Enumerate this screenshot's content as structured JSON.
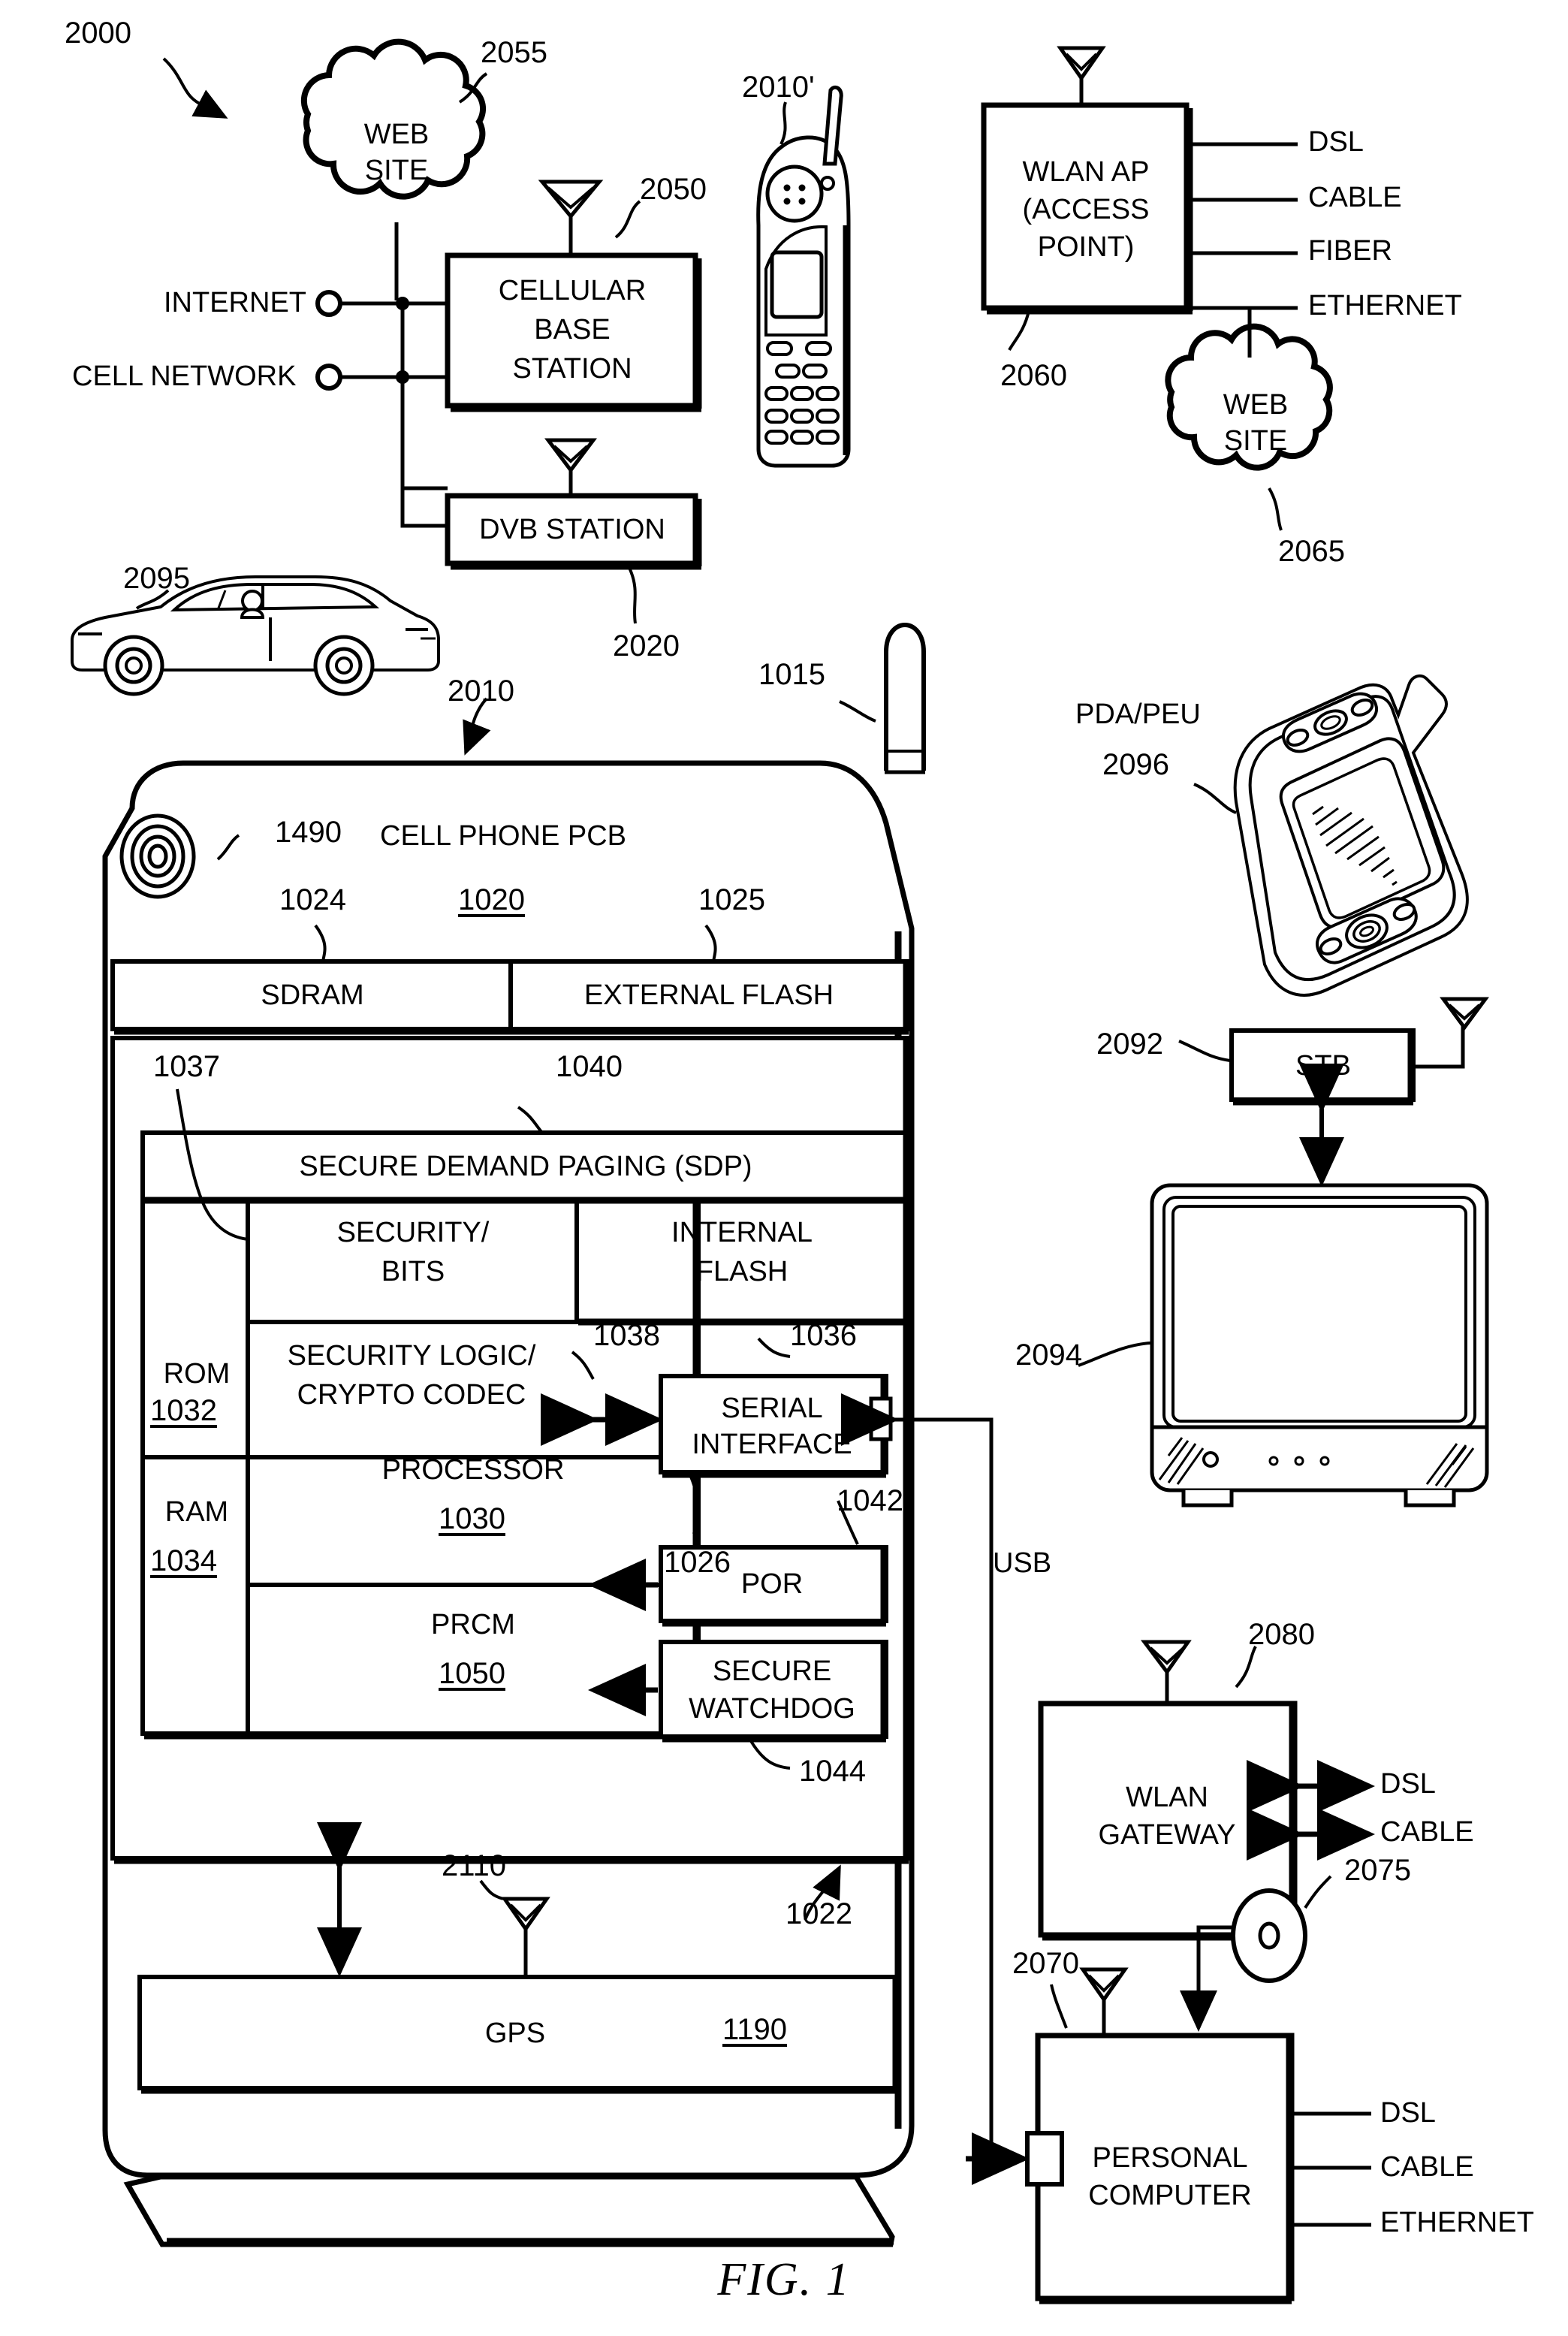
{
  "figure": {
    "caption": "FIG. 1",
    "system_ref": "2000"
  },
  "network": {
    "web_site_left": {
      "label_line1": "WEB",
      "label_line2": "SITE",
      "ref": "2055"
    },
    "web_site_right": {
      "label_line1": "WEB",
      "label_line2": "SITE",
      "ref": "2065"
    },
    "internet_port": "INTERNET",
    "cell_network_port": "CELL NETWORK",
    "cellular_base_station": {
      "line1": "CELLULAR",
      "line2": "BASE",
      "line3": "STATION",
      "ref": "2050"
    },
    "dvb_station": {
      "label": "DVB STATION",
      "ref": "2020"
    },
    "wlan_ap": {
      "line1": "WLAN AP",
      "line2": "(ACCESS",
      "line3": "POINT)",
      "ref": "2060",
      "links": [
        "DSL",
        "CABLE",
        "FIBER",
        "ETHERNET"
      ]
    },
    "wlan_gateway": {
      "line1": "WLAN",
      "line2": "GATEWAY",
      "ref": "2080",
      "links": [
        "DSL",
        "CABLE"
      ]
    },
    "personal_computer": {
      "line1": "PERSONAL",
      "line2": "COMPUTER",
      "ref": "2070",
      "links": [
        "DSL",
        "CABLE",
        "ETHERNET"
      ],
      "disc_ref": "2075"
    },
    "stb": {
      "label": "STB",
      "ref": "2092"
    },
    "television": {
      "ref": "2094"
    },
    "pda": {
      "label": "PDA/PEU",
      "ref": "2096"
    },
    "car": {
      "ref": "2095"
    },
    "handset": {
      "ref": "2010'"
    },
    "usb_label": "USB"
  },
  "phone": {
    "title": "CELL PHONE PCB",
    "device_ref": "2010",
    "pcb_ref": "1020",
    "speaker_ref": "1490",
    "antenna_ref": "1015",
    "chip_ref": "1022",
    "gps_link_ref": "2110",
    "memory": [
      {
        "label": "SDRAM",
        "ref": "1024"
      },
      {
        "label": "EXTERNAL FLASH",
        "ref": "1025"
      }
    ],
    "sdp": {
      "label": "SECURE DEMAND PAGING (SDP)",
      "ref": "1040"
    },
    "security_bits": {
      "line1": "SECURITY/",
      "line2": "BITS",
      "ref": "1037"
    },
    "internal_flash": {
      "line1": "INTERNAL",
      "line2": "FLASH",
      "ref": "1036",
      "ref2": "1038"
    },
    "rom": {
      "label": "ROM",
      "ref": "1032"
    },
    "ram": {
      "label": "RAM",
      "ref": "1034"
    },
    "crypto": {
      "line1": "SECURITY LOGIC/",
      "line2": "CRYPTO CODEC"
    },
    "processor": {
      "label": "PROCESSOR",
      "ref": "1030"
    },
    "prcm": {
      "label": "PRCM",
      "ref": "1050"
    },
    "serial_interface": {
      "line1": "SERIAL",
      "line2": "INTERFACE",
      "ref": "1026"
    },
    "por": {
      "label": "POR",
      "ref": "1042"
    },
    "secure_watchdog": {
      "line1": "SECURE",
      "line2": "WATCHDOG",
      "ref": "1044"
    },
    "gps": {
      "label": "GPS",
      "ref": "1190"
    }
  }
}
